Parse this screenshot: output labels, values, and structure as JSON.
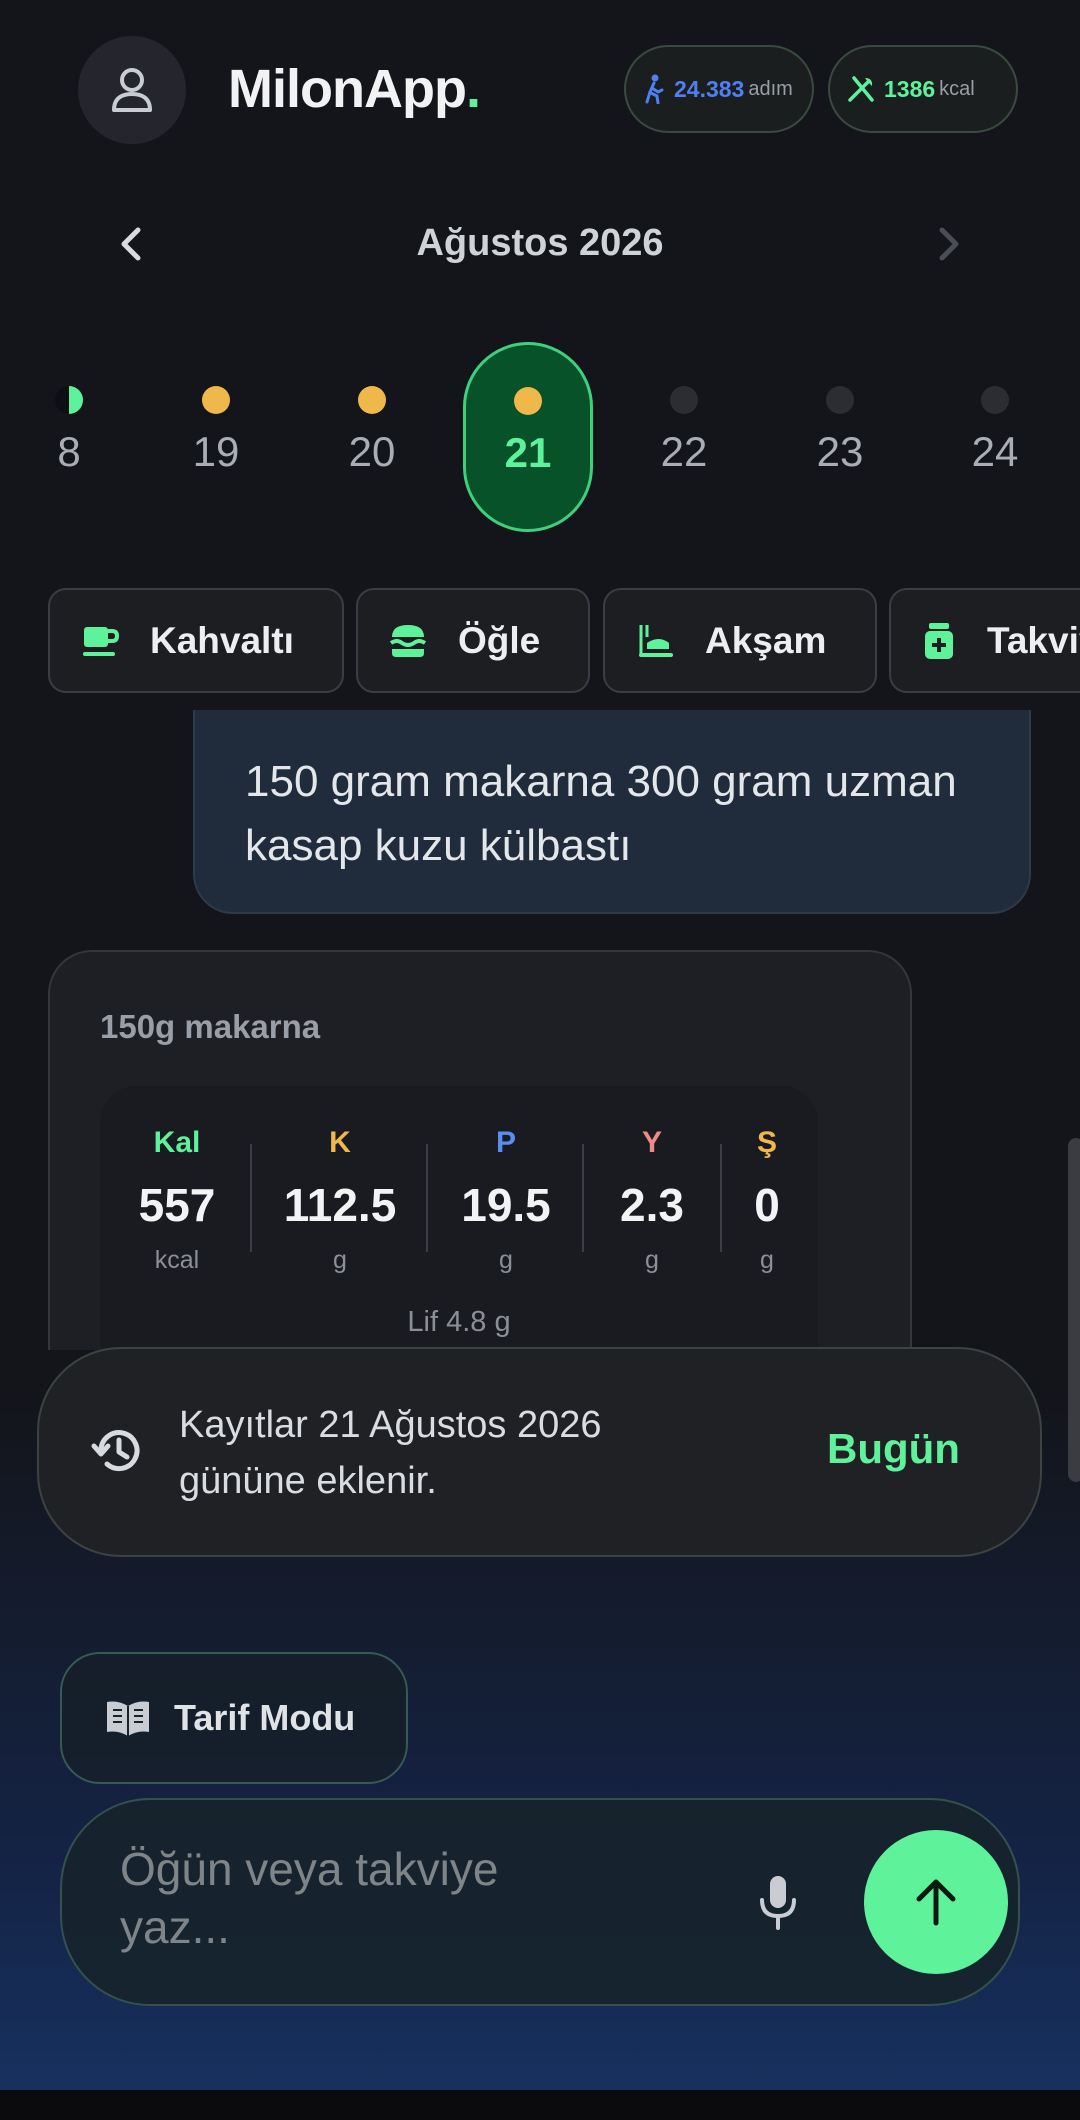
{
  "header": {
    "app_name": "MilonApp",
    "app_name_dot": ".",
    "steps_value": "24.383",
    "steps_unit": "adım",
    "calories_value": "1386",
    "calories_unit": "kcal"
  },
  "calendar": {
    "month_title": "Ağustos 2026",
    "days": [
      {
        "num": "8",
        "dot": "half-green"
      },
      {
        "num": "19",
        "dot": "yellow"
      },
      {
        "num": "20",
        "dot": "yellow"
      },
      {
        "num": "21",
        "dot": "yellow",
        "selected": true
      },
      {
        "num": "22",
        "dot": "empty"
      },
      {
        "num": "23",
        "dot": "empty"
      },
      {
        "num": "24",
        "dot": "empty"
      }
    ]
  },
  "meal_tabs": [
    {
      "label": "Kahvaltı",
      "icon": "coffee-cup-icon"
    },
    {
      "label": "Öğle",
      "icon": "burger-icon"
    },
    {
      "label": "Akşam",
      "icon": "dinner-icon"
    },
    {
      "label": "Takviye",
      "icon": "supplement-icon"
    }
  ],
  "chat": {
    "user_message": "150 gram makarna 300 gram uzman kasap kuzu külbastı"
  },
  "nutrition": {
    "title": "150g makarna",
    "macros": [
      {
        "key": "Kal",
        "value": "557",
        "unit": "kcal",
        "color": "#5ef29a"
      },
      {
        "key": "K",
        "value": "112.5",
        "unit": "g",
        "color": "#f0b84a"
      },
      {
        "key": "P",
        "value": "19.5",
        "unit": "g",
        "color": "#5b8cf0"
      },
      {
        "key": "Y",
        "value": "2.3",
        "unit": "g",
        "color": "#f08a8a"
      },
      {
        "key": "Ş",
        "value": "0",
        "unit": "g",
        "color": "#f0b84a"
      }
    ],
    "fiber": "Lif 4.8 g"
  },
  "toast": {
    "message": "Kayıtlar 21 Ağustos 2026 gününe eklenir.",
    "action": "Bugün"
  },
  "recipe_mode": {
    "label": "Tarif Modu"
  },
  "composer": {
    "placeholder": "Öğün veya takviye yaz..."
  },
  "colors": {
    "accent": "#5ef29a",
    "steps_blue": "#4f7ff0",
    "dot_yellow": "#f0b84a",
    "background": "#14151b"
  }
}
